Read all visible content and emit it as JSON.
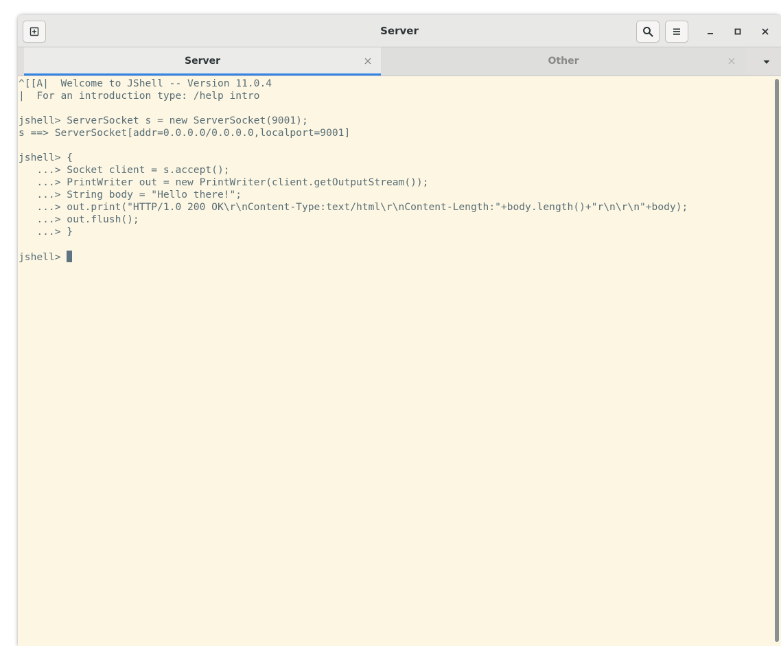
{
  "window": {
    "title": "Server"
  },
  "titlebar": {
    "new_tab_icon": "new-tab-icon",
    "search_icon": "search-icon",
    "menu_icon": "hamburger-menu-icon",
    "minimize_icon": "minimize-icon",
    "maximize_icon": "maximize-icon",
    "close_icon": "close-icon"
  },
  "tabs": [
    {
      "label": "Server",
      "active": true
    },
    {
      "label": "Other",
      "active": false
    }
  ],
  "terminal": {
    "lines": [
      "^[[A|  Welcome to JShell -- Version 11.0.4",
      "|  For an introduction type: /help intro",
      "",
      "jshell> ServerSocket s = new ServerSocket(9001);",
      "s ==> ServerSocket[addr=0.0.0.0/0.0.0.0,localport=9001]",
      "",
      "jshell> {",
      "   ...> Socket client = s.accept();",
      "   ...> PrintWriter out = new PrintWriter(client.getOutputStream());",
      "   ...> String body = \"Hello there!\";",
      "   ...> out.print(\"HTTP/1.0 200 OK\\r\\nContent-Type:text/html\\r\\nContent-Length:\"+body.length()+\"r\\n\\r\\n\"+body);",
      "   ...> out.flush();",
      "   ...> }",
      ""
    ],
    "prompt": "jshell> "
  },
  "colors": {
    "terminal_bg": "#fdf6e3",
    "terminal_fg": "#586e75",
    "accent": "#3584e4"
  }
}
